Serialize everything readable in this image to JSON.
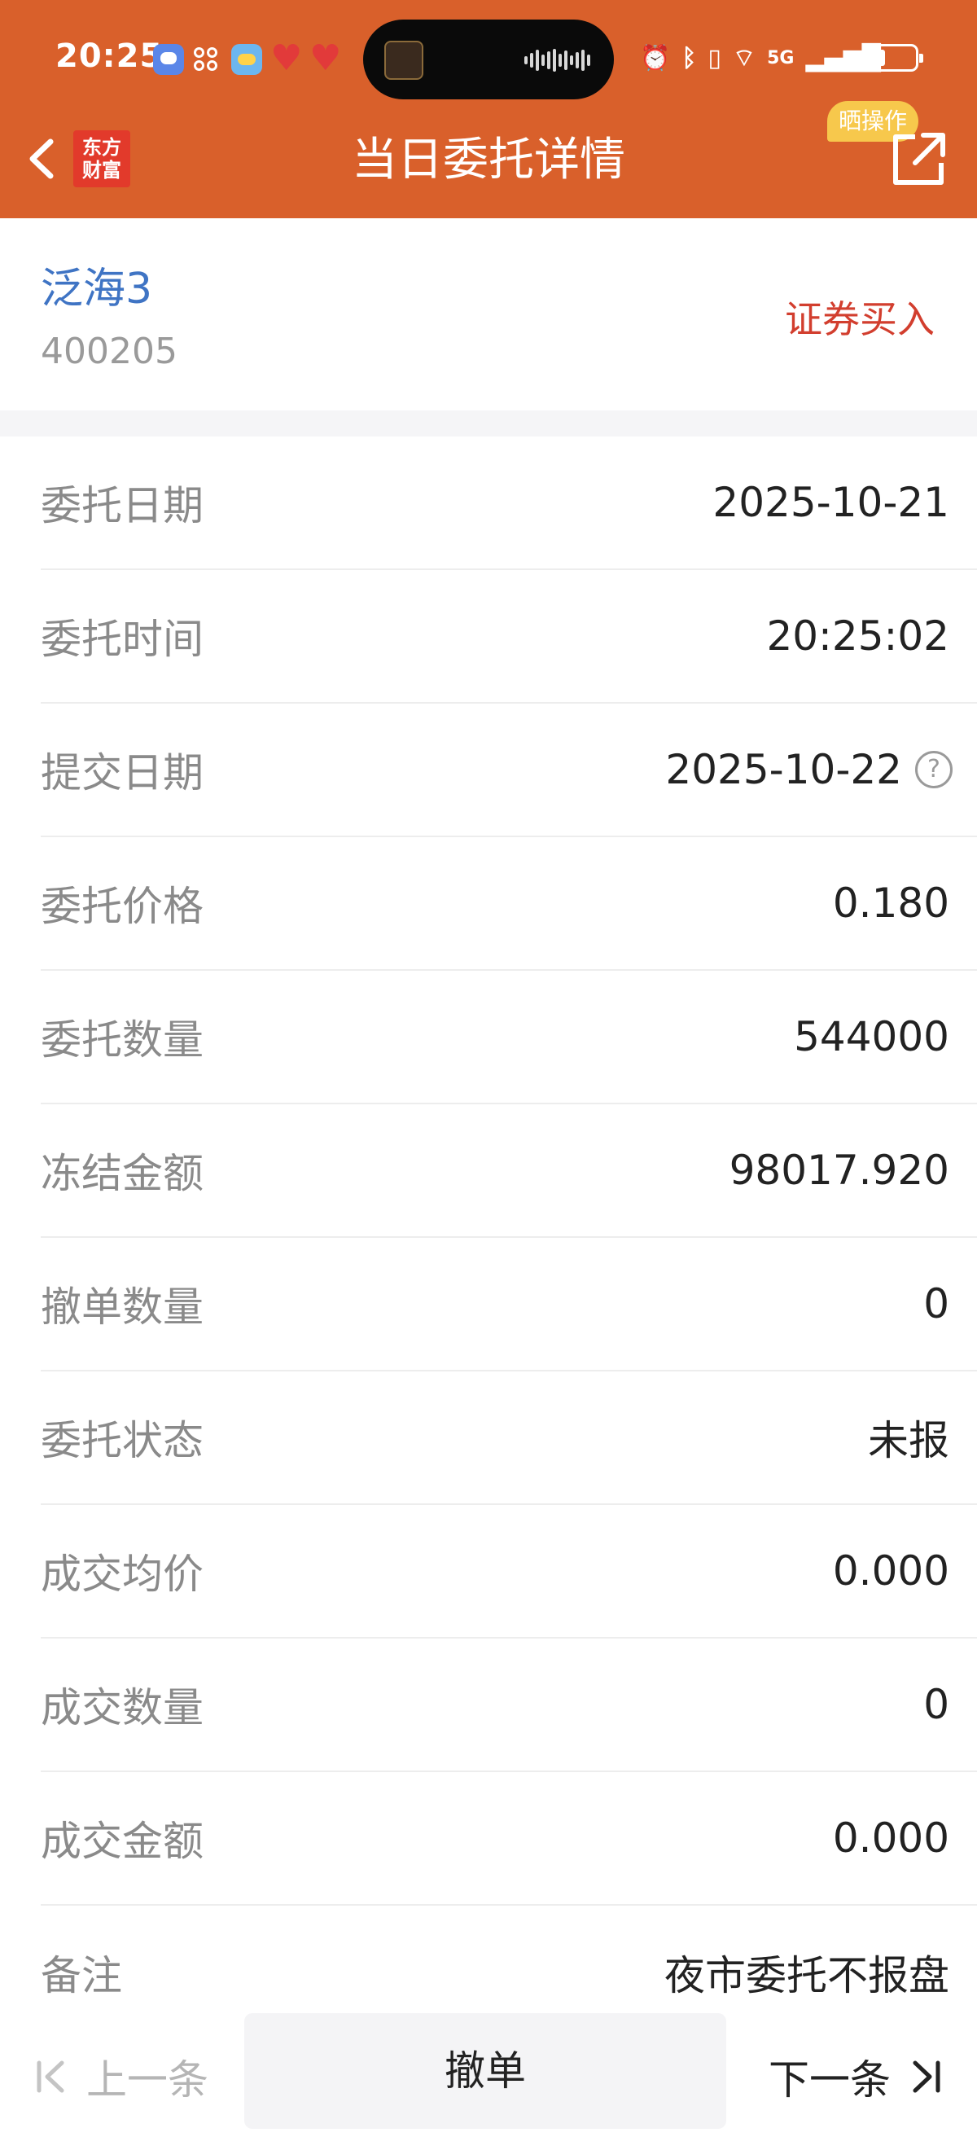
{
  "status_bar": {
    "time": "20:25",
    "icons": [
      "message-icon",
      "grid-icon",
      "weather-icon",
      "heart-icon",
      "heart-icon",
      "alarm-icon",
      "bluetooth-icon",
      "vibrate-icon",
      "wifi-icon",
      "5g-signal-icon",
      "battery-icon"
    ],
    "network": "5G"
  },
  "header": {
    "title": "当日委托详情",
    "logo_line1": "东方",
    "logo_line2": "财富",
    "share_badge": "晒操作",
    "background_color": "#d9602b"
  },
  "stock": {
    "name": "泛海3",
    "code": "400205",
    "trade_type": "证券买入"
  },
  "details": [
    {
      "label": "委托日期",
      "value": "2025-10-21"
    },
    {
      "label": "委托时间",
      "value": "20:25:02"
    },
    {
      "label": "提交日期",
      "value": "2025-10-22"
    },
    {
      "label": "委托价格",
      "value": "0.180"
    },
    {
      "label": "委托数量",
      "value": "544000"
    },
    {
      "label": "冻结金额",
      "value": "98017.920"
    },
    {
      "label": "撤单数量",
      "value": "0"
    },
    {
      "label": "委托状态",
      "value": "未报"
    },
    {
      "label": "成交均价",
      "value": "0.000"
    },
    {
      "label": "成交数量",
      "value": "0"
    },
    {
      "label": "成交金额",
      "value": "0.000"
    },
    {
      "label": "备注",
      "value": "夜市委托不报盘"
    }
  ],
  "footer": {
    "prev_label": "上一条",
    "cancel_label": "撤单",
    "next_label": "下一条"
  }
}
